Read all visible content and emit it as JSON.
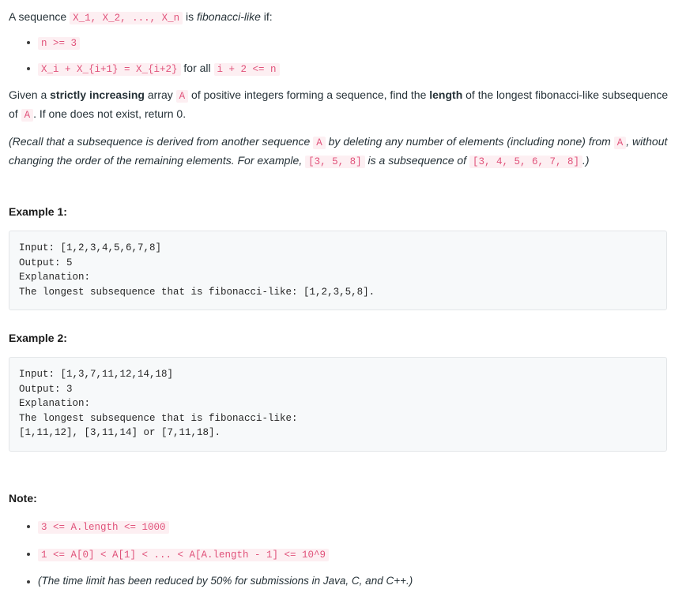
{
  "intro": {
    "lead_a": "A sequence ",
    "lead_code": "X_1, X_2, ..., X_n",
    "lead_b": " is ",
    "lead_em": "fibonacci-like",
    "lead_c": " if:",
    "bullets": [
      {
        "code": "n >= 3",
        "suffix": ""
      },
      {
        "code": "X_i + X_{i+1} = X_{i+2}",
        "mid": " for all ",
        "code2": "i + 2 <= n"
      }
    ]
  },
  "problem": {
    "p1_a": "Given a ",
    "p1_bold": "strictly increasing",
    "p1_b": " array ",
    "p1_code1": "A",
    "p1_c": " of positive integers forming a sequence, find the ",
    "p1_bold2": "length",
    "p1_d": " of the longest fibonacci-like subsequence of ",
    "p1_code2": "A",
    "p1_e": ".  If one does not exist, return 0.",
    "recall_a": "(Recall that a subsequence is derived from another sequence ",
    "recall_code1": "A",
    "recall_b": " by deleting any number of elements (including none) from ",
    "recall_code2": "A",
    "recall_c": ", without changing the order of the remaining elements.  For example, ",
    "recall_code3": "[3, 5, 8]",
    "recall_d": " is a subsequence of ",
    "recall_code4": "[3, 4, 5, 6, 7, 8]",
    "recall_e": ".)"
  },
  "examples": [
    {
      "title": "Example 1:",
      "body": "Input: [1,2,3,4,5,6,7,8]\nOutput: 5\nExplanation:\nThe longest subsequence that is fibonacci-like: [1,2,3,5,8]."
    },
    {
      "title": "Example 2:",
      "body": "Input: [1,3,7,11,12,14,18]\nOutput: 3\nExplanation:\nThe longest subsequence that is fibonacci-like:\n[1,11,12], [3,11,14] or [7,11,18]."
    }
  ],
  "note": {
    "title": "Note:",
    "items": [
      {
        "type": "code",
        "text": "3 <= A.length <= 1000"
      },
      {
        "type": "code",
        "text": "1 <= A[0] < A[1] < ... < A[A.length - 1] <= 10^9"
      },
      {
        "type": "italic",
        "text": "(The time limit has been reduced by 50% for submissions in Java, C, and C++.)"
      }
    ]
  },
  "colors": {
    "inline_code_bg": "#fdeff2",
    "inline_code_fg": "#e0527a",
    "code_block_bg": "#f7f9fa",
    "code_block_border": "#e3e6e8",
    "text": "#263238"
  }
}
